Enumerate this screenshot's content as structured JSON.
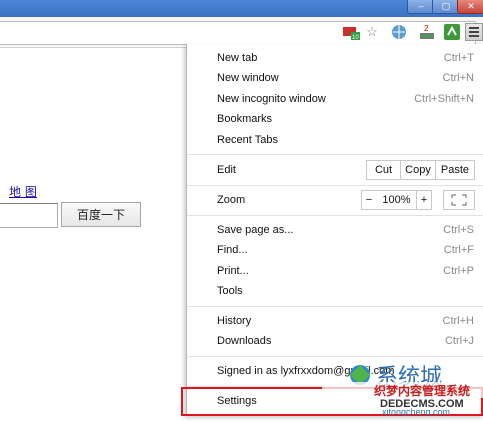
{
  "browser": {
    "window_buttons": [
      "–",
      "▢",
      "✕"
    ],
    "badge_count": "2",
    "badge_count2": "10"
  },
  "page": {
    "link_map": "地 图",
    "search_value": "",
    "search_button": "百度一下"
  },
  "menu": {
    "new_tab": {
      "label": "New tab",
      "shortcut": "Ctrl+T"
    },
    "new_window": {
      "label": "New window",
      "shortcut": "Ctrl+N"
    },
    "new_incognito": {
      "label": "New incognito window",
      "shortcut": "Ctrl+Shift+N"
    },
    "bookmarks": {
      "label": "Bookmarks"
    },
    "recent_tabs": {
      "label": "Recent Tabs"
    },
    "edit": {
      "label": "Edit",
      "cut": "Cut",
      "copy": "Copy",
      "paste": "Paste"
    },
    "zoom": {
      "label": "Zoom",
      "minus": "−",
      "level": "100%",
      "plus": "+"
    },
    "save_page": {
      "label": "Save page as...",
      "shortcut": "Ctrl+S"
    },
    "find": {
      "label": "Find...",
      "shortcut": "Ctrl+F"
    },
    "print": {
      "label": "Print...",
      "shortcut": "Ctrl+P"
    },
    "tools": {
      "label": "Tools"
    },
    "history": {
      "label": "History",
      "shortcut": "Ctrl+H"
    },
    "downloads": {
      "label": "Downloads",
      "shortcut": "Ctrl+J"
    },
    "signed_in": {
      "label": "Signed in as lyxfrxxdom@gmail.com"
    },
    "settings": {
      "label": "Settings"
    }
  },
  "watermark": {
    "line1": "系统城",
    "line2": "织梦内容管理系统",
    "line3": "DEDECMS.COM",
    "line4": "xitongcheng.com"
  },
  "colors": {
    "accent": "#3d72c2",
    "highlight": "#e0161d"
  }
}
